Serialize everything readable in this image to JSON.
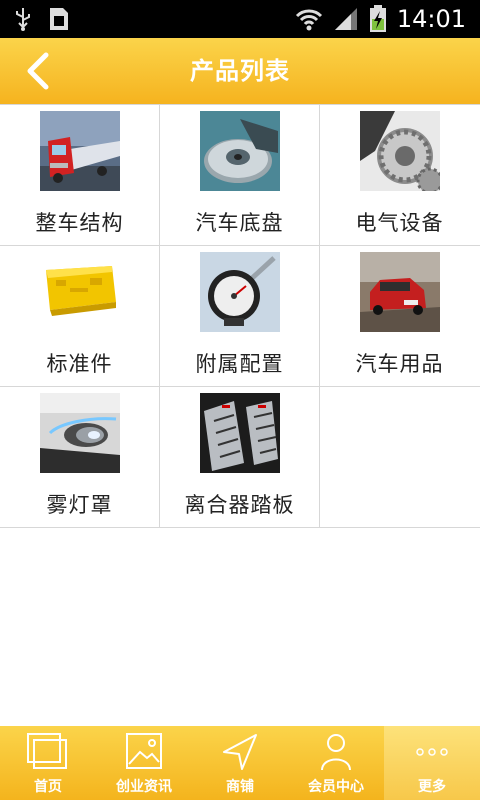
{
  "status_bar": {
    "time": "14:01",
    "icons": [
      "usb-icon",
      "sim-icon",
      "wifi-icon",
      "signal-icon",
      "battery-icon"
    ]
  },
  "header": {
    "title": "产品列表",
    "back_icon": "back-arrow-icon"
  },
  "products": [
    {
      "label": "整车结构",
      "image": "truck-photo"
    },
    {
      "label": "汽车底盘",
      "image": "brake-disc-photo"
    },
    {
      "label": "电气设备",
      "image": "gears-photo"
    },
    {
      "label": "标准件",
      "image": "yellow-bracket-photo"
    },
    {
      "label": "附属配置",
      "image": "tire-gauge-photo"
    },
    {
      "label": "汽车用品",
      "image": "red-car-photo"
    },
    {
      "label": "雾灯罩",
      "image": "fog-lamp-photo"
    },
    {
      "label": "离合器踏板",
      "image": "pedals-photo"
    }
  ],
  "bottom_nav": [
    {
      "label": "首页",
      "icon": "home-icon"
    },
    {
      "label": "创业资讯",
      "icon": "image-icon"
    },
    {
      "label": "商铺",
      "icon": "navigation-arrow-icon"
    },
    {
      "label": "会员中心",
      "icon": "user-icon"
    },
    {
      "label": "更多",
      "icon": "more-dots-icon",
      "active": true
    }
  ],
  "colors": {
    "header_top": "#fbd44a",
    "header_bottom": "#f5b31f",
    "grid_line": "#d7d7d7",
    "text": "#222222"
  }
}
